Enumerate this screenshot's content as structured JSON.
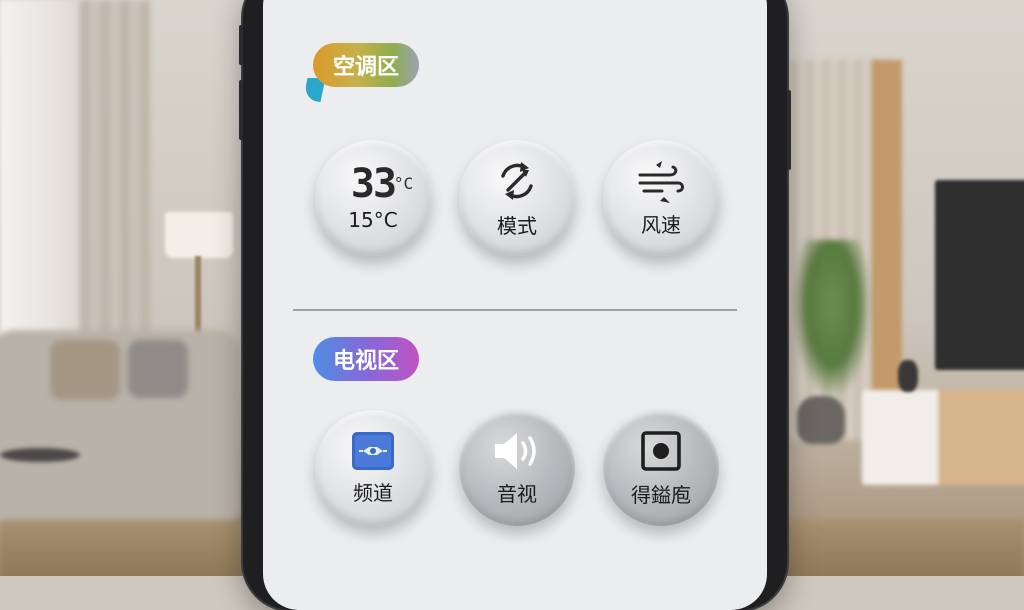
{
  "sections": {
    "ac": {
      "label": "空调区",
      "buttons": {
        "temperature": {
          "current": "33",
          "unit": "°C",
          "setpoint": "15°C",
          "icon": "temperature-display"
        },
        "mode": {
          "label": "模式",
          "icon": "cycle-arrows-icon"
        },
        "fan_speed": {
          "label": "风速",
          "icon": "wind-icon"
        }
      }
    },
    "tv": {
      "label": "电视区",
      "buttons": {
        "channel": {
          "label": "频道",
          "icon": "channel-icon"
        },
        "volume": {
          "label": "音视",
          "icon": "speaker-icon"
        },
        "third": {
          "label": "得鎰庖",
          "icon": "record-icon"
        }
      }
    }
  },
  "colors": {
    "screen_bg": "#ecedef",
    "ac_tag_gradient": [
      "#d99a2b",
      "#8fae4f",
      "#9aa2b5"
    ],
    "tv_tag_gradient": [
      "#4f8de2",
      "#8a67d8",
      "#c053c2"
    ],
    "channel_icon_blue": "#3b69c9"
  }
}
